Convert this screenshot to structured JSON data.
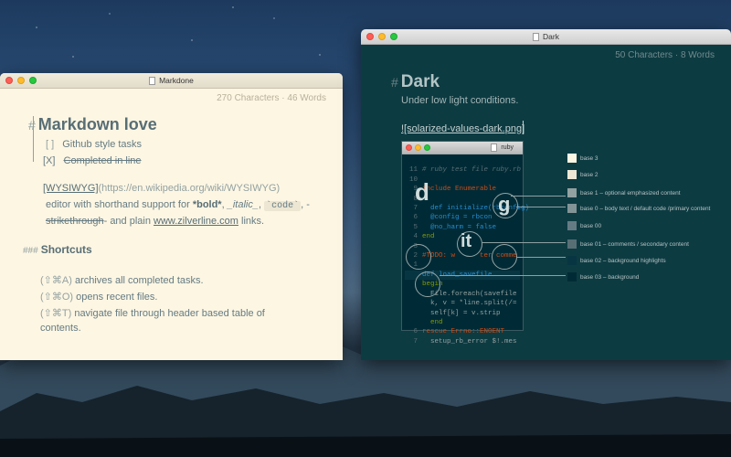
{
  "light_window": {
    "title": "Markdone",
    "stats": "270 Characters · 46 Words",
    "heading_hash": "#",
    "heading": "Markdown love",
    "task1": {
      "box": "[ ]",
      "text": "Github style tasks"
    },
    "task2": {
      "box": "[X]",
      "text": "Completed in line"
    },
    "para": {
      "link_text": "[WYSIWYG]",
      "link_url": "(https://en.wikipedia.org/wiki/WYSIWYG)",
      "l2_a": "editor with shorthand support for ",
      "bold": "*bold*",
      "l2_b": ", ",
      "italic": "_italic_",
      "l2_c": ", ",
      "code": "`code`",
      "l2_d": ", -",
      "strike": "strikethrough",
      "l3_a": "- and plain ",
      "url": "www.zilverline.com",
      "l3_b": " links."
    },
    "section_hashes": "###",
    "section": "Shortcuts",
    "shortcuts": [
      {
        "key": "(⇧⌘A)",
        "text": " archives all completed tasks."
      },
      {
        "key": "(⇧⌘O)",
        "text": " opens recent files."
      },
      {
        "key": "(⇧⌘T)",
        "text": " navigate file through header based table of"
      }
    ],
    "shortcuts_tail": "contents."
  },
  "dark_window": {
    "title": "Dark",
    "stats": "50 Characters · 8 Words",
    "heading_hash": "#",
    "heading": "Dark",
    "subtitle": "Under low light conditions.",
    "image_md": "![solarized-values-dark.png]",
    "embed": {
      "code_title": "ruby",
      "lines": [
        {
          "n": "11",
          "t": "# ruby test file ruby.rb"
        },
        {
          "n": "10",
          "t": ""
        },
        {
          "n": "9",
          "t": "include Enumerable"
        },
        {
          "n": "8",
          "t": ""
        },
        {
          "n": "7",
          "t": "  def initialize(rbconfig)"
        },
        {
          "n": "6",
          "t": "  @config = rbcon"
        },
        {
          "n": "5",
          "t": "  @no_harm = false"
        },
        {
          "n": "4",
          "t": "end"
        },
        {
          "n": "3",
          "t": ""
        },
        {
          "n": "2",
          "t": "#TODO: w      ter comme"
        },
        {
          "n": "1",
          "t": ""
        },
        {
          "n": "",
          "t": "def load_savefile"
        },
        {
          "n": "",
          "t": "begin"
        },
        {
          "n": "",
          "t": "  File.foreach(savefile"
        },
        {
          "n": "",
          "t": "  k, v = *line.split(/="
        },
        {
          "n": "",
          "t": "  self[k] = v.strip"
        },
        {
          "n": "",
          "t": "  end"
        },
        {
          "n": "6",
          "t": "rescue Errno::ENOENT"
        },
        {
          "n": "7",
          "t": "  setup_rb_error $!.mes"
        }
      ],
      "glyphs": {
        "d": "d",
        "g": "g",
        "it": "it"
      },
      "legend": [
        {
          "label": "base 3",
          "color": "#fdf6e3"
        },
        {
          "label": "base 2",
          "color": "#eee8d5"
        },
        {
          "label": "base 1 – optional emphasized content",
          "color": "#93a1a1"
        },
        {
          "label": "base 0 – body text / default code /primary content",
          "color": "#839496"
        },
        {
          "label": "base 00",
          "color": "#657b83"
        },
        {
          "label": "base 01 – comments / secondary content",
          "color": "#586e75"
        },
        {
          "label": "base 02 – background highlights",
          "color": "#073642"
        },
        {
          "label": "base 03 – background",
          "color": "#002b36"
        }
      ]
    }
  }
}
